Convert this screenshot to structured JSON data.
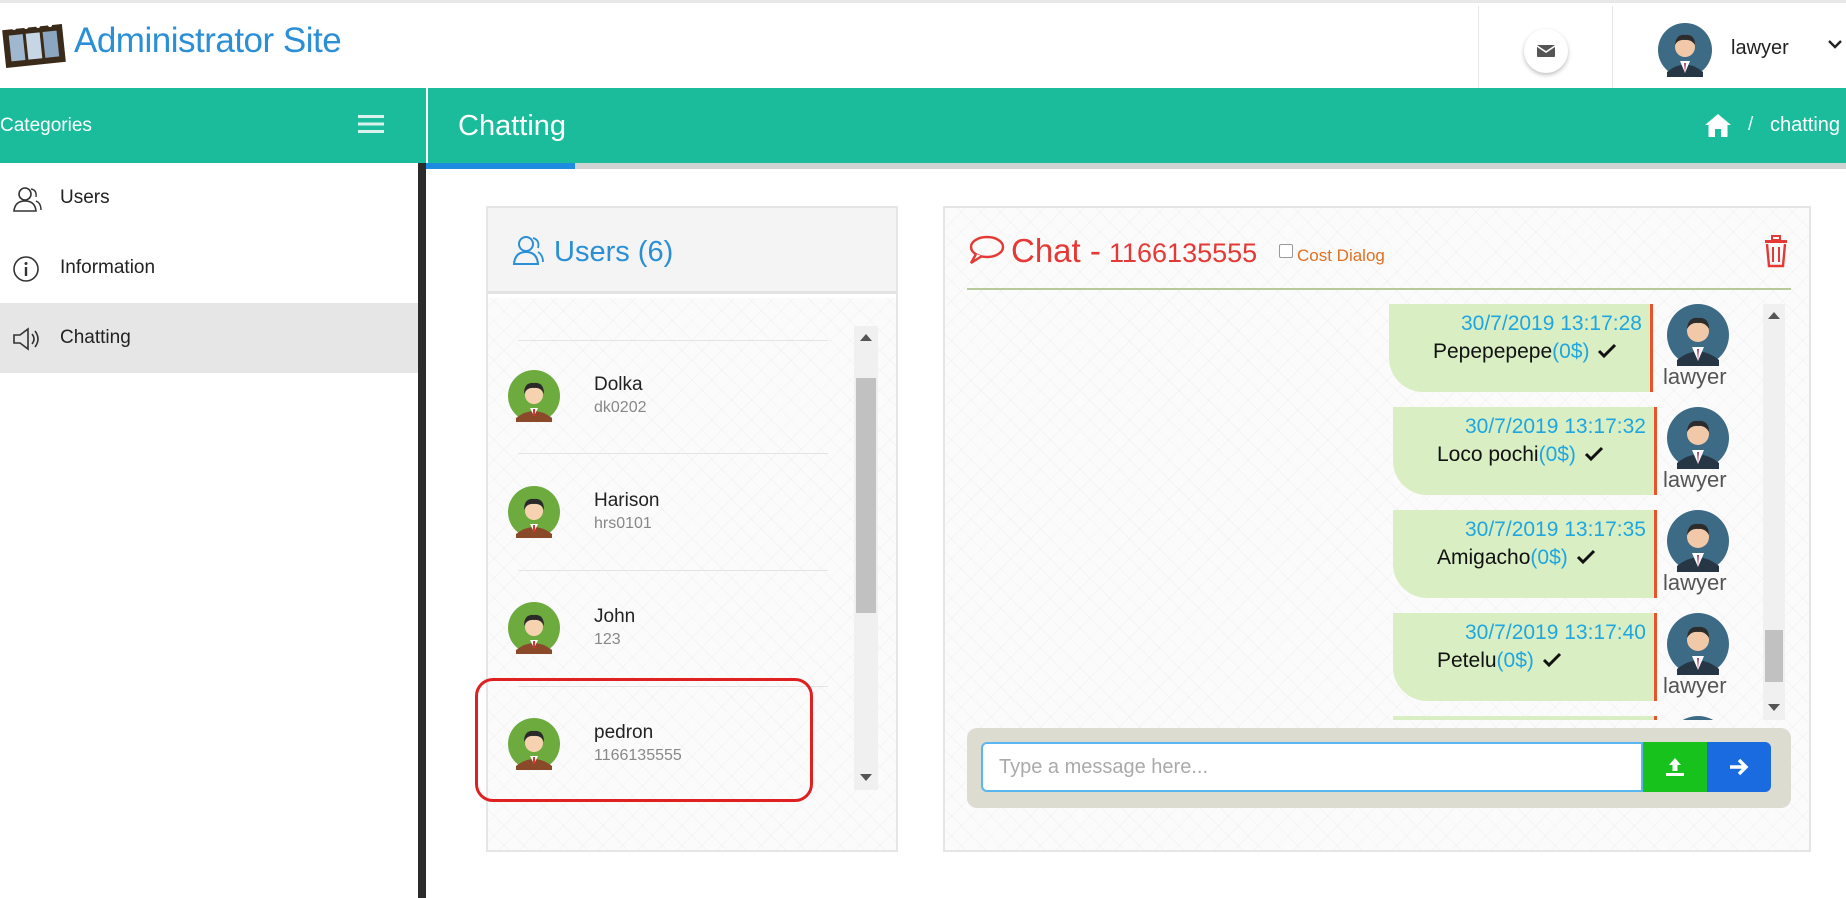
{
  "header": {
    "site_title": "Administrator Site",
    "user_name": "lawyer",
    "icons": [
      "film-logo",
      "envelope-icon",
      "user-avatar",
      "chevron-down-icon"
    ]
  },
  "sidebar": {
    "title": "Categories",
    "items": [
      {
        "label": "Users",
        "icon": "users-icon",
        "active": false
      },
      {
        "label": "Information",
        "icon": "info-icon",
        "active": false
      },
      {
        "label": "Chatting",
        "icon": "speaker-icon",
        "active": true
      }
    ]
  },
  "titlebar": {
    "title": "Chatting",
    "breadcrumb_separator": "/",
    "breadcrumb_current": "chatting"
  },
  "progress": {
    "fraction": 0.105
  },
  "users_panel": {
    "title": "Users (6)",
    "users": [
      {
        "name": "Dolka",
        "sub": "dk0202"
      },
      {
        "name": "Harison",
        "sub": "hrs0101"
      },
      {
        "name": "John",
        "sub": "123"
      },
      {
        "name": "pedron",
        "sub": "1166135555",
        "highlighted": true
      }
    ],
    "scroll_fraction": 0.42
  },
  "chat": {
    "title": "Chat -",
    "number": "1166135555",
    "cost_dialog_label": "Cost Dialog",
    "cost_dialog_checked": false,
    "messages": [
      {
        "time": "30/7/2019 13:17:28",
        "text": "Pepepepepe",
        "cost": "(0$)",
        "author": "lawyer"
      },
      {
        "time": "30/7/2019 13:17:32",
        "text": "Loco pochi",
        "cost": "(0$)",
        "author": "lawyer"
      },
      {
        "time": "30/7/2019 13:17:35",
        "text": "Amigacho",
        "cost": "(0$)",
        "author": "lawyer"
      },
      {
        "time": "30/7/2019 13:17:40",
        "text": "Petelu",
        "cost": "(0$)",
        "author": "lawyer"
      }
    ],
    "input_placeholder": "Type a message here...",
    "input_value": ""
  },
  "colors": {
    "teal": "#1abc9c",
    "blue": "#2a8fd6",
    "red": "#e53935",
    "bubble": "#d9efc3",
    "upload": "#16c21b",
    "send": "#1a6ae0"
  }
}
